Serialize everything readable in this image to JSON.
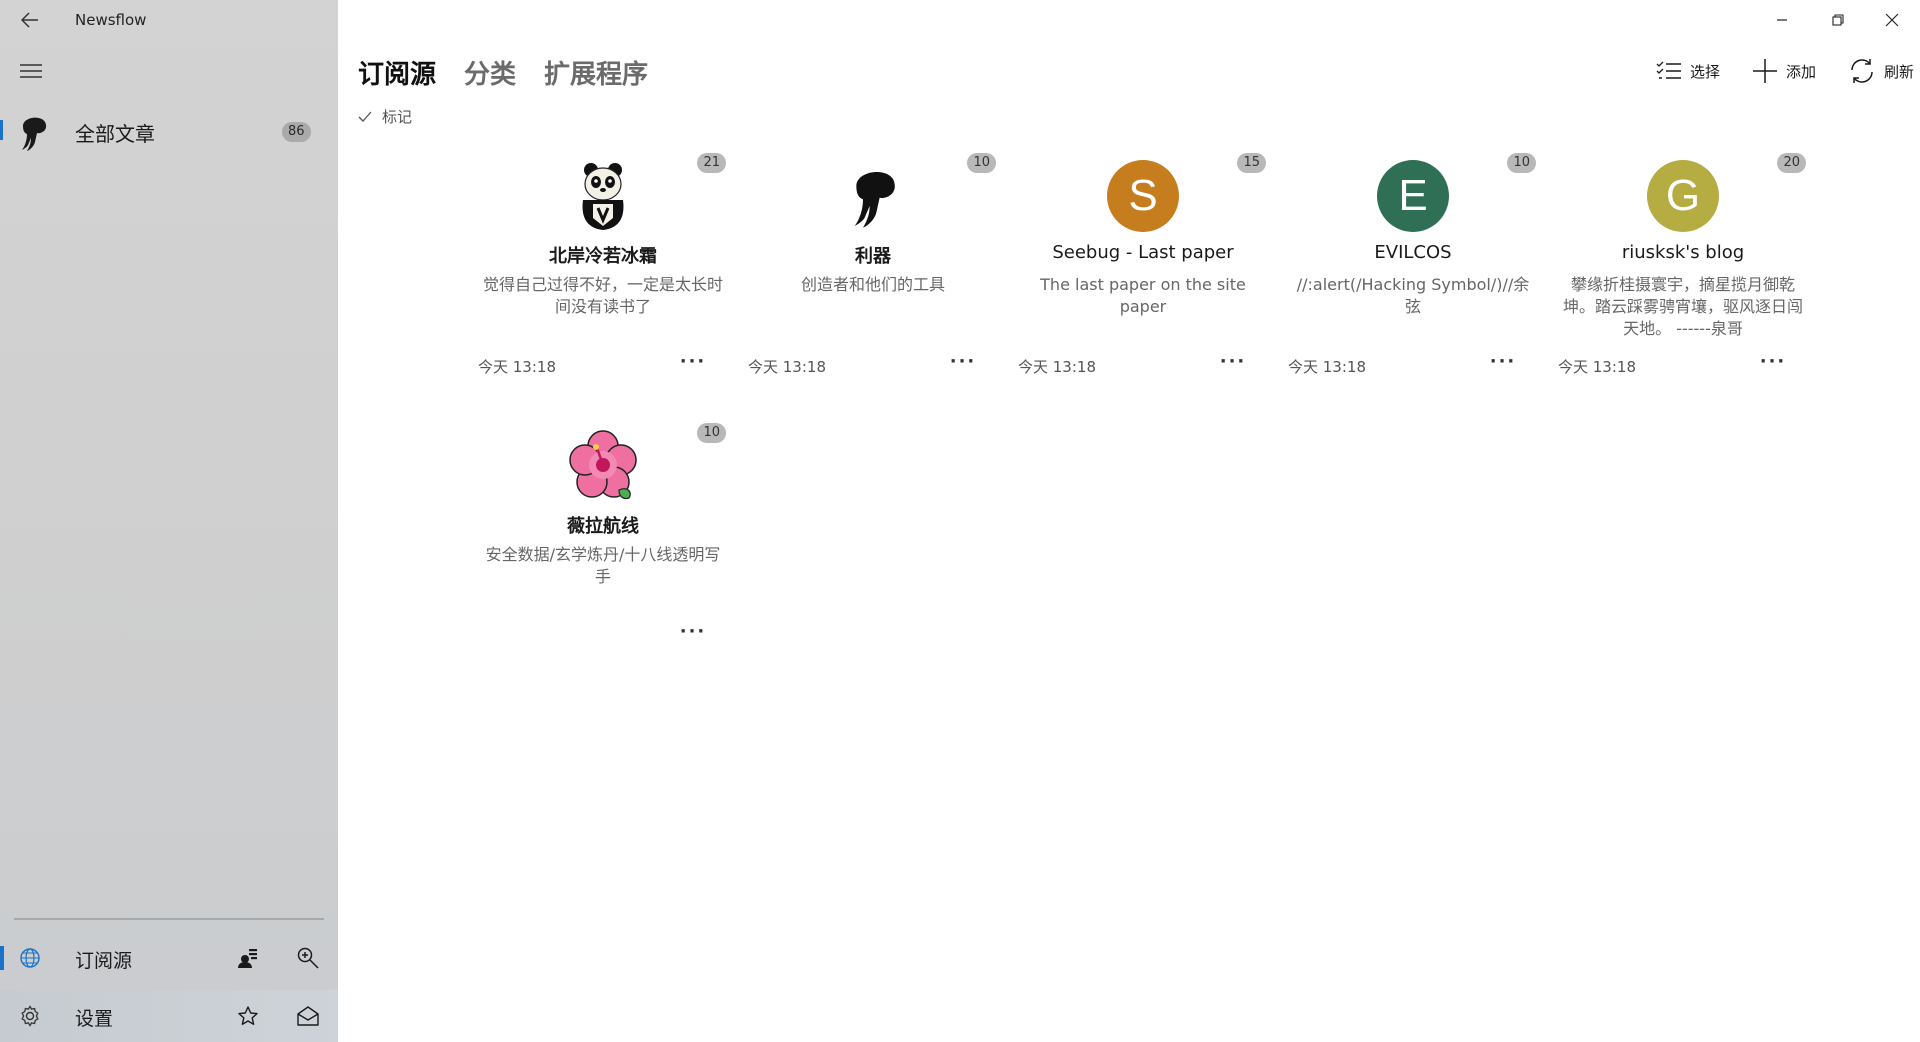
{
  "app": {
    "title": "Newsflow"
  },
  "sidebar": {
    "all_articles": {
      "label": "全部文章",
      "count": "86"
    },
    "bottom": {
      "feeds_label": "订阅源",
      "settings_label": "设置"
    }
  },
  "main": {
    "tabs": [
      {
        "label": "订阅源",
        "active": true
      },
      {
        "label": "分类",
        "active": false
      },
      {
        "label": "扩展程序",
        "active": false
      }
    ],
    "mark_label": "标记",
    "commands": {
      "select": "选择",
      "add": "添加",
      "refresh": "刷新"
    },
    "feeds": [
      {
        "name": "北岸冷若冰霜",
        "desc": "觉得自己过得不好，一定是太长时间没有读书了",
        "time": "今天 13:18",
        "count": "21",
        "icon": "panda-icon"
      },
      {
        "name": "利器",
        "desc": "创造者和他们的工具",
        "time": "今天 13:18",
        "count": "10",
        "icon": "jellyfish-icon"
      },
      {
        "name": "Seebug - Last paper",
        "desc": "The last paper on the site paper",
        "time": "今天 13:18",
        "count": "15",
        "icon": "letter-avatar",
        "letter": "S",
        "color": "#c57d1e"
      },
      {
        "name": "EVILCOS",
        "desc": "//:alert(/Hacking Symbol/)//余弦",
        "time": "今天 13:18",
        "count": "10",
        "icon": "letter-avatar",
        "letter": "E",
        "color": "#2e6f55"
      },
      {
        "name": "riusksk's blog",
        "desc": "攀缘折桂摄寰宇，摘星揽月御乾坤。踏云踩雾骋宵壤，驱风逐日闯天地。 ------泉哥",
        "time": "今天 13:18",
        "count": "20",
        "icon": "letter-avatar",
        "letter": "G",
        "color": "#b5ad42"
      },
      {
        "name": "薇拉航线",
        "desc": "安全数据/玄学炼丹/十八线透明写手",
        "time": "",
        "count": "10",
        "icon": "hibiscus-icon"
      }
    ],
    "more_label": "···"
  }
}
